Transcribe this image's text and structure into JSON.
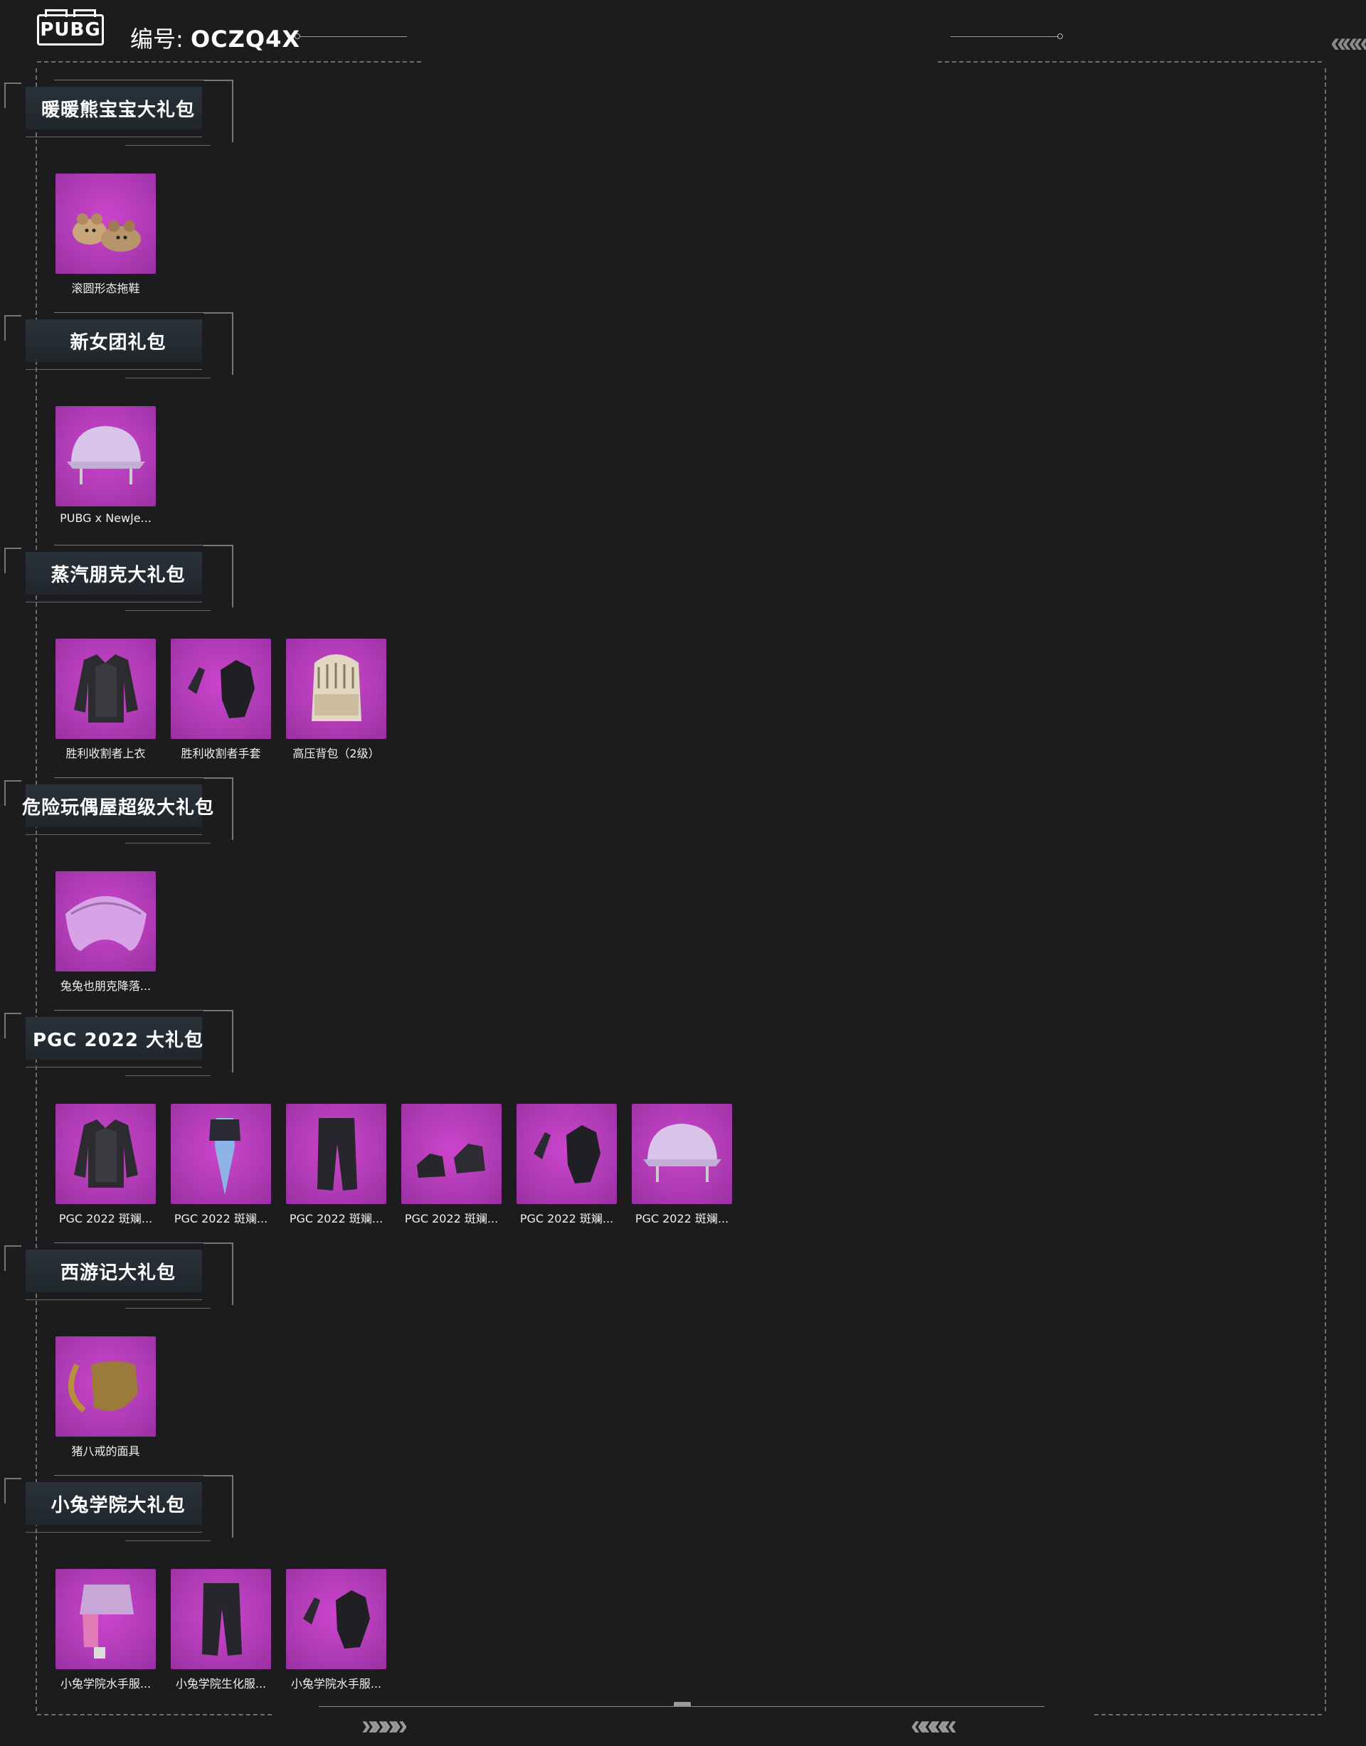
{
  "header": {
    "logo_text": "PUBG",
    "code_label": "编号:",
    "code_value": "OCZQ4X"
  },
  "colors": {
    "background": "#1c1c1e",
    "item_bg": "#b13cb6",
    "frame": "#6e6e6e"
  },
  "sections": [
    {
      "title": "暖暖熊宝宝大礼包",
      "items": [
        {
          "label": "滚圆形态拖鞋",
          "icon": "bear-slippers-icon"
        }
      ]
    },
    {
      "title": "新女团礼包",
      "items": [
        {
          "label": "PUBG x NewJe...",
          "icon": "helmet-icon"
        }
      ]
    },
    {
      "title": "蒸汽朋克大礼包",
      "items": [
        {
          "label": "胜利收割者上衣",
          "icon": "jacket-icon"
        },
        {
          "label": "胜利收割者手套",
          "icon": "gloves-icon"
        },
        {
          "label": "高压背包（2级）",
          "icon": "backpack-icon"
        }
      ]
    },
    {
      "title": "危险玩偶屋超级大礼包",
      "items": [
        {
          "label": "兔兔也朋克降落...",
          "icon": "parachute-icon"
        }
      ]
    },
    {
      "title": "PGC 2022 大礼包",
      "items": [
        {
          "label": "PGC 2022 斑斓...",
          "icon": "jacket-icon"
        },
        {
          "label": "PGC 2022 斑斓...",
          "icon": "mask-icon"
        },
        {
          "label": "PGC 2022 斑斓...",
          "icon": "pants-icon"
        },
        {
          "label": "PGC 2022 斑斓...",
          "icon": "shoes-icon"
        },
        {
          "label": "PGC 2022 斑斓...",
          "icon": "gloves-icon"
        },
        {
          "label": "PGC 2022 斑斓...",
          "icon": "helmet-icon"
        }
      ]
    },
    {
      "title": "西游记大礼包",
      "items": [
        {
          "label": "猪八戒的面具",
          "icon": "horned-mask-icon"
        }
      ]
    },
    {
      "title": "小兔学院大礼包",
      "items": [
        {
          "label": "小兔学院水手服...",
          "icon": "skirt-icon"
        },
        {
          "label": "小兔学院生化服...",
          "icon": "pants-icon"
        },
        {
          "label": "小兔学院水手服...",
          "icon": "gloves-icon"
        }
      ]
    }
  ]
}
